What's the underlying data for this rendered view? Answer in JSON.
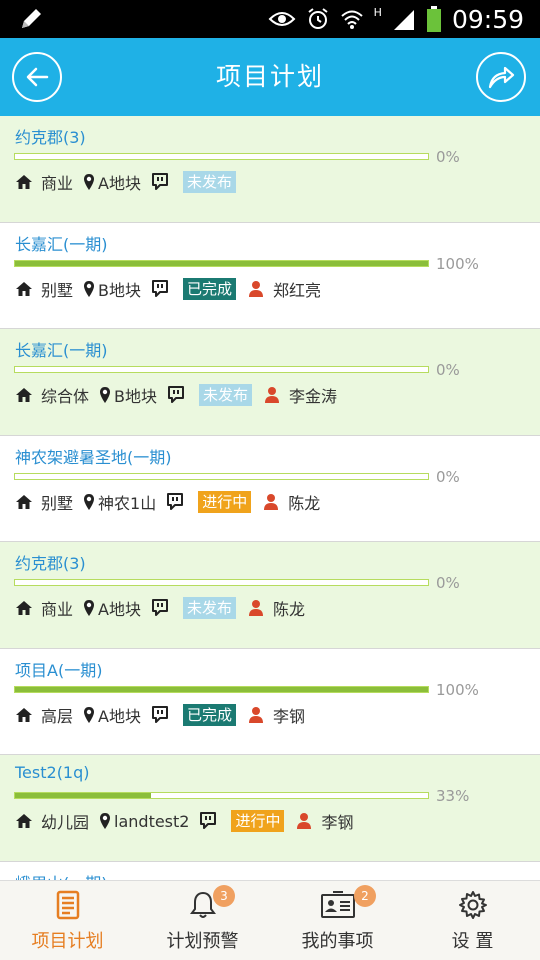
{
  "status_bar": {
    "time": "09:59",
    "network": "H"
  },
  "header": {
    "title": "项目计划",
    "back_icon": "back-arrow-icon",
    "share_icon": "share-icon",
    "color": "#1fb1e6"
  },
  "status_colors": {
    "未发布": "#a9d8e8",
    "已完成": "#1b7a72",
    "进行中": "#f0a31c"
  },
  "projects": [
    {
      "name": "约克郡(3)",
      "progress": 0,
      "percent": "0%",
      "type": "商业",
      "plot": "A地块",
      "status": "未发布",
      "owner": "",
      "bg": "green"
    },
    {
      "name": "长嘉汇(一期)",
      "progress": 100,
      "percent": "100%",
      "type": "别墅",
      "plot": "B地块",
      "status": "已完成",
      "owner": "郑红亮",
      "bg": "white"
    },
    {
      "name": "长嘉汇(一期)",
      "progress": 0,
      "percent": "0%",
      "type": "综合体",
      "plot": "B地块",
      "status": "未发布",
      "owner": "李金涛",
      "bg": "green"
    },
    {
      "name": "神农架避暑圣地(一期)",
      "progress": 0,
      "percent": "0%",
      "type": "别墅",
      "plot": "神农1山",
      "status": "进行中",
      "owner": "陈龙",
      "bg": "white"
    },
    {
      "name": "约克郡(3)",
      "progress": 0,
      "percent": "0%",
      "type": "商业",
      "plot": "A地块",
      "status": "未发布",
      "owner": "陈龙",
      "bg": "green"
    },
    {
      "name": "项目A(一期)",
      "progress": 100,
      "percent": "100%",
      "type": "高层",
      "plot": "A地块",
      "status": "已完成",
      "owner": "李钢",
      "bg": "white"
    },
    {
      "name": "Test2(1q)",
      "progress": 33,
      "percent": "33%",
      "type": "幼儿园",
      "plot": "landtest2",
      "status": "进行中",
      "owner": "李钢",
      "bg": "green"
    },
    {
      "name": "峨眉山(一期)",
      "progress": 0,
      "percent": "",
      "type": "",
      "plot": "",
      "status": "",
      "owner": "",
      "bg": "white"
    }
  ],
  "bottom_nav": [
    {
      "label": "项目计划",
      "icon": "document-icon",
      "active": true,
      "badge": ""
    },
    {
      "label": "计划预警",
      "icon": "bell-icon",
      "active": false,
      "badge": "3"
    },
    {
      "label": "我的事项",
      "icon": "id-card-icon",
      "active": false,
      "badge": "2"
    },
    {
      "label": "设 置",
      "icon": "gear-icon",
      "active": false,
      "badge": ""
    }
  ]
}
